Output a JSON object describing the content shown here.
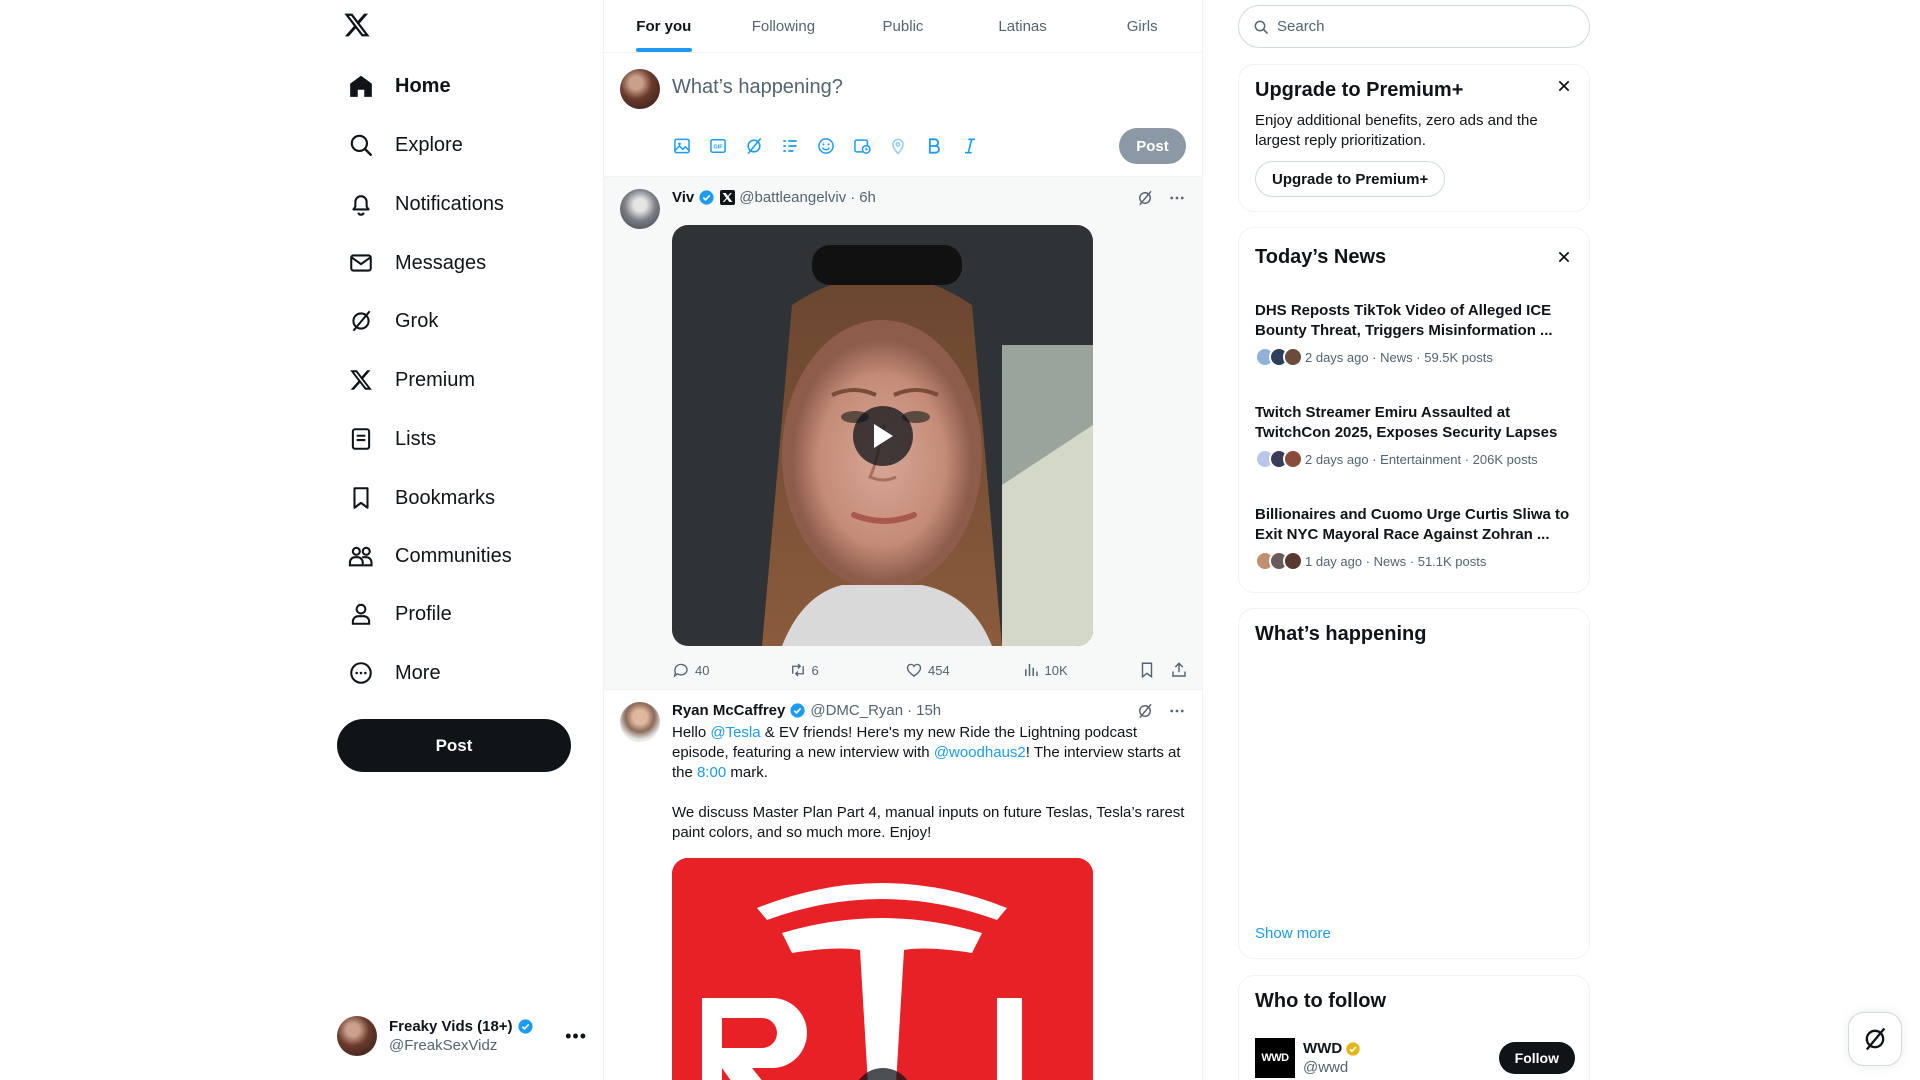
{
  "sidebar": {
    "items": [
      {
        "label": "Home",
        "icon": "home-icon"
      },
      {
        "label": "Explore",
        "icon": "search-icon"
      },
      {
        "label": "Notifications",
        "icon": "bell-icon"
      },
      {
        "label": "Messages",
        "icon": "mail-icon"
      },
      {
        "label": "Grok",
        "icon": "grok-icon"
      },
      {
        "label": "Premium",
        "icon": "x-logo-icon"
      },
      {
        "label": "Lists",
        "icon": "list-icon"
      },
      {
        "label": "Bookmarks",
        "icon": "bookmark-icon"
      },
      {
        "label": "Communities",
        "icon": "communities-icon"
      },
      {
        "label": "Profile",
        "icon": "person-icon"
      },
      {
        "label": "More",
        "icon": "more-circle-icon"
      }
    ],
    "post_label": "Post",
    "account": {
      "name": "Freaky Vids (18+)",
      "handle": "@FreakSexVidz"
    }
  },
  "tabs": [
    {
      "label": "For you",
      "active": true
    },
    {
      "label": "Following",
      "active": false
    },
    {
      "label": "Public",
      "active": false
    },
    {
      "label": "Latinas",
      "active": false
    },
    {
      "label": "Girls",
      "active": false
    }
  ],
  "composer": {
    "placeholder": "What’s happening?",
    "post_label": "Post",
    "tools": [
      "image-icon",
      "gif-icon",
      "grok-icon",
      "poll-icon",
      "emoji-icon",
      "schedule-icon",
      "location-icon",
      "bold-icon",
      "italic-icon"
    ]
  },
  "tweets": [
    {
      "name": "Viv",
      "handle": "@battleangelviv",
      "sep": "·",
      "time": "6h",
      "replies": "40",
      "reposts": "6",
      "likes": "454",
      "views": "10K"
    },
    {
      "name": "Ryan McCaffrey",
      "handle": "@DMC_Ryan",
      "sep": "·",
      "time": "15h",
      "text": {
        "p1_a": "Hello ",
        "mention1": "@Tesla",
        "p1_b": " & EV friends! Here's my new Ride the Lightning podcast episode, featuring a new interview with ",
        "mention2": "@woodhaus2",
        "p1_c": "! The interview starts at the ",
        "timestamp": "8:00",
        "p1_d": " mark.",
        "p2": "We discuss Master Plan Part 4, manual inputs on future Teslas, Tesla’s rarest paint colors, and so much more. Enjoy!"
      }
    }
  ],
  "right": {
    "search_placeholder": "Search",
    "premium": {
      "title": "Upgrade to Premium+",
      "desc": "Enjoy additional benefits, zero ads and the largest reply prioritization.",
      "button": "Upgrade to Premium+"
    },
    "news": {
      "title": "Today’s News",
      "items": [
        {
          "title": "DHS Reposts TikTok Video of Alleged ICE Bounty Threat, Triggers Misinformation ...",
          "meta": "2 days ago · News · 59.5K posts"
        },
        {
          "title": "Twitch Streamer Emiru Assaulted at TwitchCon 2025, Exposes Security Lapses",
          "meta": "2 days ago · Entertainment · 206K posts"
        },
        {
          "title": "Billionaires and Cuomo Urge Curtis Sliwa to Exit NYC Mayoral Race Against Zohran ...",
          "meta": "1 day ago · News · 51.1K posts"
        }
      ]
    },
    "happening": {
      "title": "What’s happening",
      "show_more": "Show more"
    },
    "who_to_follow": {
      "title": "Who to follow",
      "account": {
        "logo": "WWD",
        "name": "WWD",
        "handle": "@wwd",
        "button": "Follow"
      }
    }
  },
  "colors": {
    "accent": "#1d9bf0",
    "text": "#0f1419",
    "muted": "#536471",
    "tesla_red": "#e82127"
  }
}
